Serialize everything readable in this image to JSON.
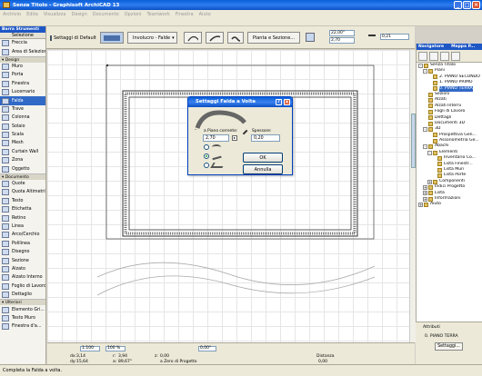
{
  "window": {
    "title": "Senza Titolo - Graphisoft ArchiCAD 13"
  },
  "menu": [
    "Archivio",
    "Edita",
    "Visualizza",
    "Design",
    "Documento",
    "Opzioni",
    "Teamwork",
    "Finestra",
    "Aiuto"
  ],
  "infobox": {
    "default_settings": "Settaggi di Default",
    "mode_label": "Involucro - Falde",
    "plan_section_label": "Pianta e Sezione...",
    "angle_value": "22,00°",
    "height_value": "2,70",
    "thickness_value": "0,21"
  },
  "toolbox": {
    "header": "Barra Strumenti",
    "selection_label": "Selezione",
    "top_items": [
      {
        "label": "Freccia"
      },
      {
        "label": "Area di Selezione"
      }
    ],
    "design_header": "Design",
    "design_items": [
      {
        "label": "Muro"
      },
      {
        "label": "Porta"
      },
      {
        "label": "Finestra"
      },
      {
        "label": "Lucernario"
      },
      {
        "label": "Falda"
      },
      {
        "label": "Trave"
      },
      {
        "label": "Colonna"
      },
      {
        "label": "Solaio"
      },
      {
        "label": "Scala"
      },
      {
        "label": "Mesh"
      },
      {
        "label": "Curtain Wall"
      },
      {
        "label": "Zona"
      },
      {
        "label": "Oggetto"
      }
    ],
    "documento_header": "Documento",
    "documento_items": [
      {
        "label": "Quote"
      },
      {
        "label": "Quota Altimetrica"
      },
      {
        "label": "Testo"
      },
      {
        "label": "Etichetta"
      },
      {
        "label": "Retino"
      },
      {
        "label": "Linea"
      },
      {
        "label": "Arco/Cerchio"
      },
      {
        "label": "Polilinea"
      },
      {
        "label": "Disegno"
      },
      {
        "label": "Sezione"
      },
      {
        "label": "Alzato"
      },
      {
        "label": "Alzato Interno"
      },
      {
        "label": "Foglio di Lavoro"
      },
      {
        "label": "Dettaglio"
      }
    ],
    "ulteriori_header": "Ulteriori",
    "ulteriori_items": [
      {
        "label": "Elemento Gri..."
      },
      {
        "label": "Testo Muro"
      },
      {
        "label": "Finestra d'a..."
      }
    ],
    "active_item": "Falda"
  },
  "dialog": {
    "title": "Settaggi Falda a Volta",
    "piano_label": "a Piano corrente:",
    "piano_value": "2,70",
    "spessore_label": "Spessore:",
    "spessore_value": "0,20",
    "ok_label": "OK",
    "cancel_label": "Annulla",
    "selected_radio": 1
  },
  "navigator": {
    "tabs": [
      "Navigatore",
      "Mappa P..."
    ],
    "tree": [
      {
        "label": "Senza Titolo",
        "depth": 0,
        "exp": "-"
      },
      {
        "label": "Piani",
        "depth": 1,
        "exp": "-"
      },
      {
        "label": "2. PIANO SECONDO",
        "depth": 2,
        "exp": ""
      },
      {
        "label": "1. PIANO PRIMO",
        "depth": 2,
        "exp": ""
      },
      {
        "label": "0. PIANO TERRA",
        "depth": 2,
        "exp": "",
        "selected": true
      },
      {
        "label": "Sezioni",
        "depth": 1,
        "exp": ""
      },
      {
        "label": "Alzati",
        "depth": 1,
        "exp": ""
      },
      {
        "label": "Alzati Interni",
        "depth": 1,
        "exp": ""
      },
      {
        "label": "Fogli di Lavoro",
        "depth": 1,
        "exp": ""
      },
      {
        "label": "Dettagli",
        "depth": 1,
        "exp": ""
      },
      {
        "label": "Documenti 3D",
        "depth": 1,
        "exp": ""
      },
      {
        "label": "3D",
        "depth": 1,
        "exp": "-"
      },
      {
        "label": "Prospettiva Gen...",
        "depth": 2,
        "exp": ""
      },
      {
        "label": "Assonometria Ge...",
        "depth": 2,
        "exp": ""
      },
      {
        "label": "Abachi",
        "depth": 1,
        "exp": "-"
      },
      {
        "label": "Elementi",
        "depth": 2,
        "exp": "-"
      },
      {
        "label": "Inventario Co...",
        "depth": 3,
        "exp": ""
      },
      {
        "label": "Lista Finestr...",
        "depth": 3,
        "exp": ""
      },
      {
        "label": "Lista Muri",
        "depth": 3,
        "exp": ""
      },
      {
        "label": "Lista Porte",
        "depth": 3,
        "exp": ""
      },
      {
        "label": "Componenti",
        "depth": 2,
        "exp": "+"
      },
      {
        "label": "Indici Progetto",
        "depth": 1,
        "exp": "+"
      },
      {
        "label": "Lista",
        "depth": 1,
        "exp": "+"
      },
      {
        "label": "Informazioni",
        "depth": 1,
        "exp": "+"
      },
      {
        "label": "Aiuto",
        "depth": 0,
        "exp": "+"
      }
    ],
    "attributes_label": "Attributi",
    "attributes_value": "0. PIANO TERRA",
    "settings_button": "Settaggi..."
  },
  "bottombar": {
    "scale": "1:100",
    "zoom": "100 %",
    "angle": "0,00°",
    "dx_label": "dx:",
    "dx_value": "3,14",
    "dy_label": "dy:",
    "dy_value": "15,64",
    "r_label": "r:",
    "r_value": "3,94",
    "a_label": "a:",
    "a_value": "89,67°",
    "z_label": "z:",
    "z_value": "0,00",
    "origin_label": "a Zero di Progetto",
    "distance_label": "Distanza",
    "distance_value": "0,00"
  },
  "status": {
    "text": "Completa la Falda a volta."
  }
}
